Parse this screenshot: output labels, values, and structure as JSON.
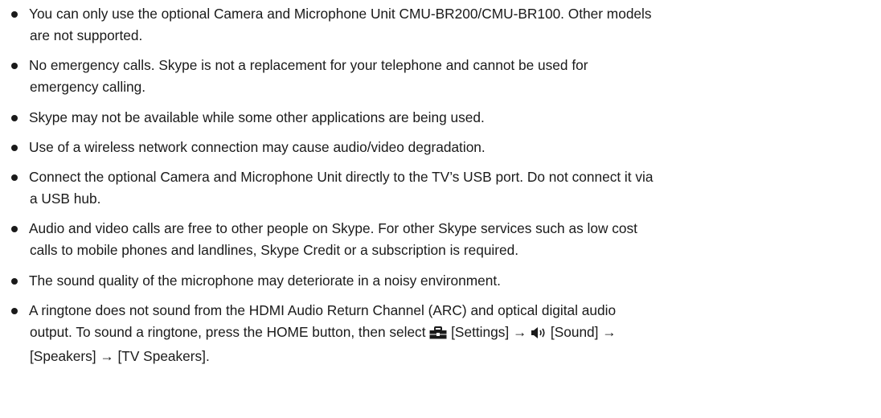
{
  "notes": [
    {
      "line1": "You can only use the optional Camera and Microphone Unit CMU-BR200/CMU-BR100. Other models",
      "line2": "are not supported."
    },
    {
      "line1": "No emergency calls. Skype is not a replacement for your telephone and cannot be used for",
      "line2": "emergency calling."
    },
    {
      "line1": "Skype may not be available while some other applications are being used."
    },
    {
      "line1": "Use of a wireless network connection may cause audio/video degradation."
    },
    {
      "line1": "Connect the optional Camera and Microphone Unit directly to the TV’s USB port. Do not connect it via",
      "line2": "a USB hub."
    },
    {
      "line1": "Audio and video calls are free to other people on Skype. For other Skype services such as low cost",
      "line2": "calls to mobile phones and landlines, Skype Credit or a subscription is required."
    },
    {
      "line1": "The sound quality of the microphone may deteriorate in a noisy environment."
    },
    {
      "line1": "A ringtone does not sound from the HDMI Audio Return Channel (ARC) and optical digital audio",
      "line2_pre": "output. To sound a ringtone, press the HOME button, then select",
      "line2_settings": "[Settings] →",
      "line2_sound": "[Sound] →",
      "line3": "[Speakers] → [TV Speakers]."
    }
  ],
  "icons": {
    "settings": "settings-toolbox-icon",
    "sound": "speaker-sound-icon"
  }
}
